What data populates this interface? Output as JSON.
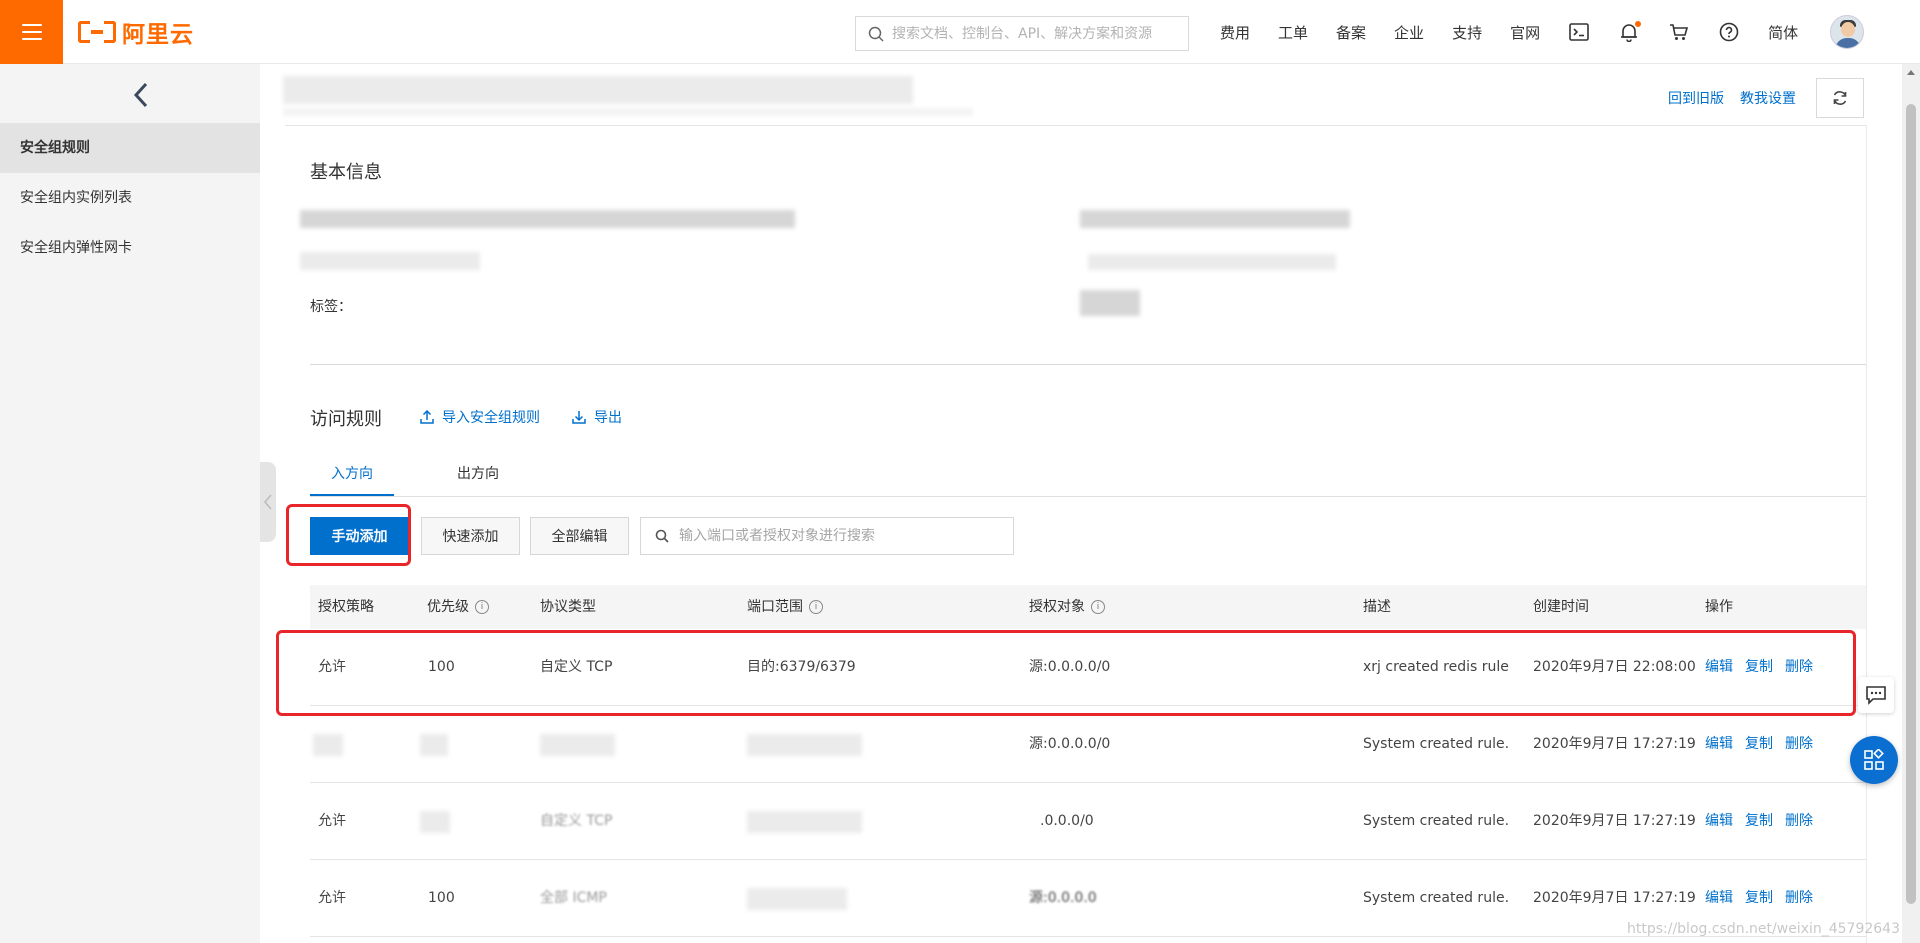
{
  "topbar": {
    "logo_text": "阿里云",
    "search_placeholder": "搜索文档、控制台、API、解决方案和资源",
    "nav": [
      "费用",
      "工单",
      "备案",
      "企业",
      "支持",
      "官网"
    ],
    "lang": "简体",
    "brand_color": "#ff6a00"
  },
  "sidebar": {
    "items": [
      "安全组规则",
      "安全组内实例列表",
      "安全组内弹性网卡"
    ]
  },
  "header": {
    "back_old": "回到旧版",
    "tutorial_settings": "教我设置"
  },
  "basic_info": {
    "title": "基本信息",
    "tag_label": "标签："
  },
  "rules": {
    "title": "访问规则",
    "import_label": "导入安全组规则",
    "export_label": "导出",
    "tabs": [
      "入方向",
      "出方向"
    ],
    "add_manual": "手动添加",
    "add_quick": "快速添加",
    "edit_all": "全部编辑",
    "search_placeholder": "输入端口或者授权对象进行搜索",
    "columns": [
      "授权策略",
      "优先级",
      "协议类型",
      "端口范围",
      "授权对象",
      "描述",
      "创建时间",
      "操作"
    ],
    "row_actions": [
      "编辑",
      "复制",
      "删除"
    ],
    "rows": [
      {
        "policy": "允许",
        "priority": "100",
        "protocol": "自定义 TCP",
        "port": "目的:6379/6379",
        "source": "源:0.0.0.0/0",
        "desc": "xrj created redis rule",
        "time": "2020年9月7日 22:08:00"
      },
      {
        "policy": "",
        "priority": "",
        "protocol": "",
        "port": "",
        "source": "源:0.0.0.0/0",
        "desc": "System created rule.",
        "time": "2020年9月7日 17:27:19"
      },
      {
        "policy": "允许",
        "priority": "",
        "protocol": "自定义 TCP",
        "port": "",
        "source": ".0.0.0/0",
        "desc": "System created rule.",
        "time": "2020年9月7日 17:27:19"
      },
      {
        "policy": "允许",
        "priority": "100",
        "protocol": "全部 ICMP",
        "port": "",
        "source": "源:0.0.0.0",
        "desc": "System created rule.",
        "time": "2020年9月7日 17:27:19"
      }
    ],
    "accent_color": "#0070cc",
    "highlight_color": "#e8262a"
  },
  "watermark": "https://blog.csdn.net/weixin_45792643"
}
